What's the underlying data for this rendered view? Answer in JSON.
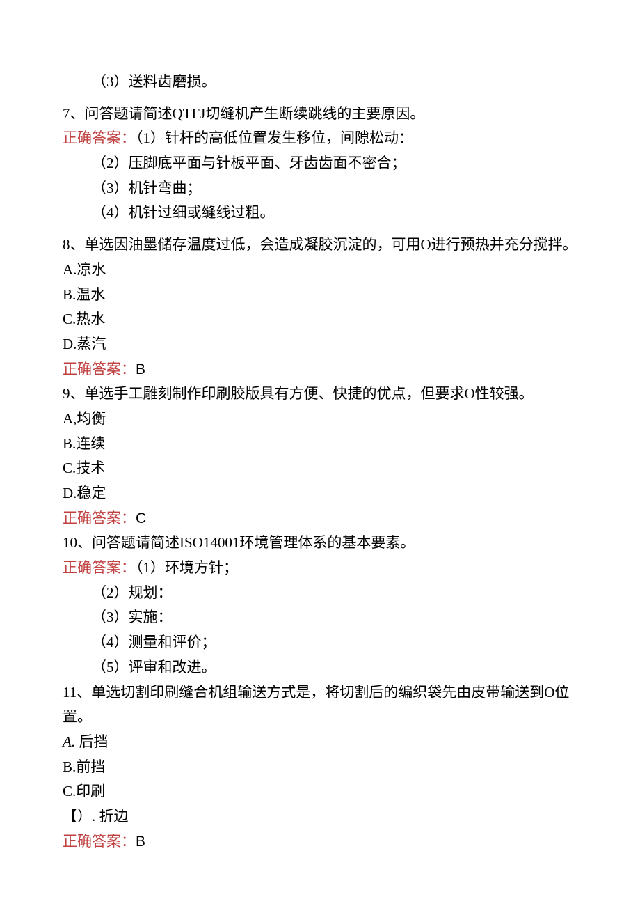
{
  "prev_tail": "（3）送料齿磨损。",
  "q7": {
    "q": "7、问答题请简述QTFJ切缝机产生断续跳线的主要原因。",
    "ans_label": "正确答案：",
    "ans1": "（1）针杆的高低位置发生移位，间隙松动：",
    "ans2": "（2）压脚底平面与针板平面、牙齿齿面不密合；",
    "ans3": "（3）机针弯曲；",
    "ans4": "（4）机针过细或缝线过粗。"
  },
  "q8": {
    "q": "8、单选因油墨储存温度过低，会造成凝胶沉淀的，可用O进行预热并充分搅拌。",
    "a": "A.凉水",
    "b": "B.温水",
    "c": "C.热水",
    "d": "D.蒸汽",
    "ans_label": "正确答案：",
    "ans": "B"
  },
  "q9": {
    "q": "9、单选手工雕刻制作印刷胶版具有方便、快捷的优点，但要求O性较强。",
    "a": "A,均衡",
    "b": "B.连续",
    "c": "C.技术",
    "d": "D.稳定",
    "ans_label": "正确答案：",
    "ans": "C"
  },
  "q10": {
    "q": "10、问答题请简述ISO14001环境管理体系的基本要素。",
    "ans_label": "正确答案：",
    "ans1": "（1）环境方针；",
    "ans2": "（2）规划：",
    "ans3": "（3）实施：",
    "ans4": "（4）测量和评价；",
    "ans5": "（5）评审和改进。"
  },
  "q11": {
    "q": "11、单选切割印刷缝合机组输送方式是，将切割后的编织袋先由皮带输送到O位 置。",
    "a": "A. 后挡",
    "b": "B.前挡",
    "c": "C.印刷",
    "d": "【）. 折边",
    "ans_label": "正确答案：",
    "ans": "B"
  }
}
